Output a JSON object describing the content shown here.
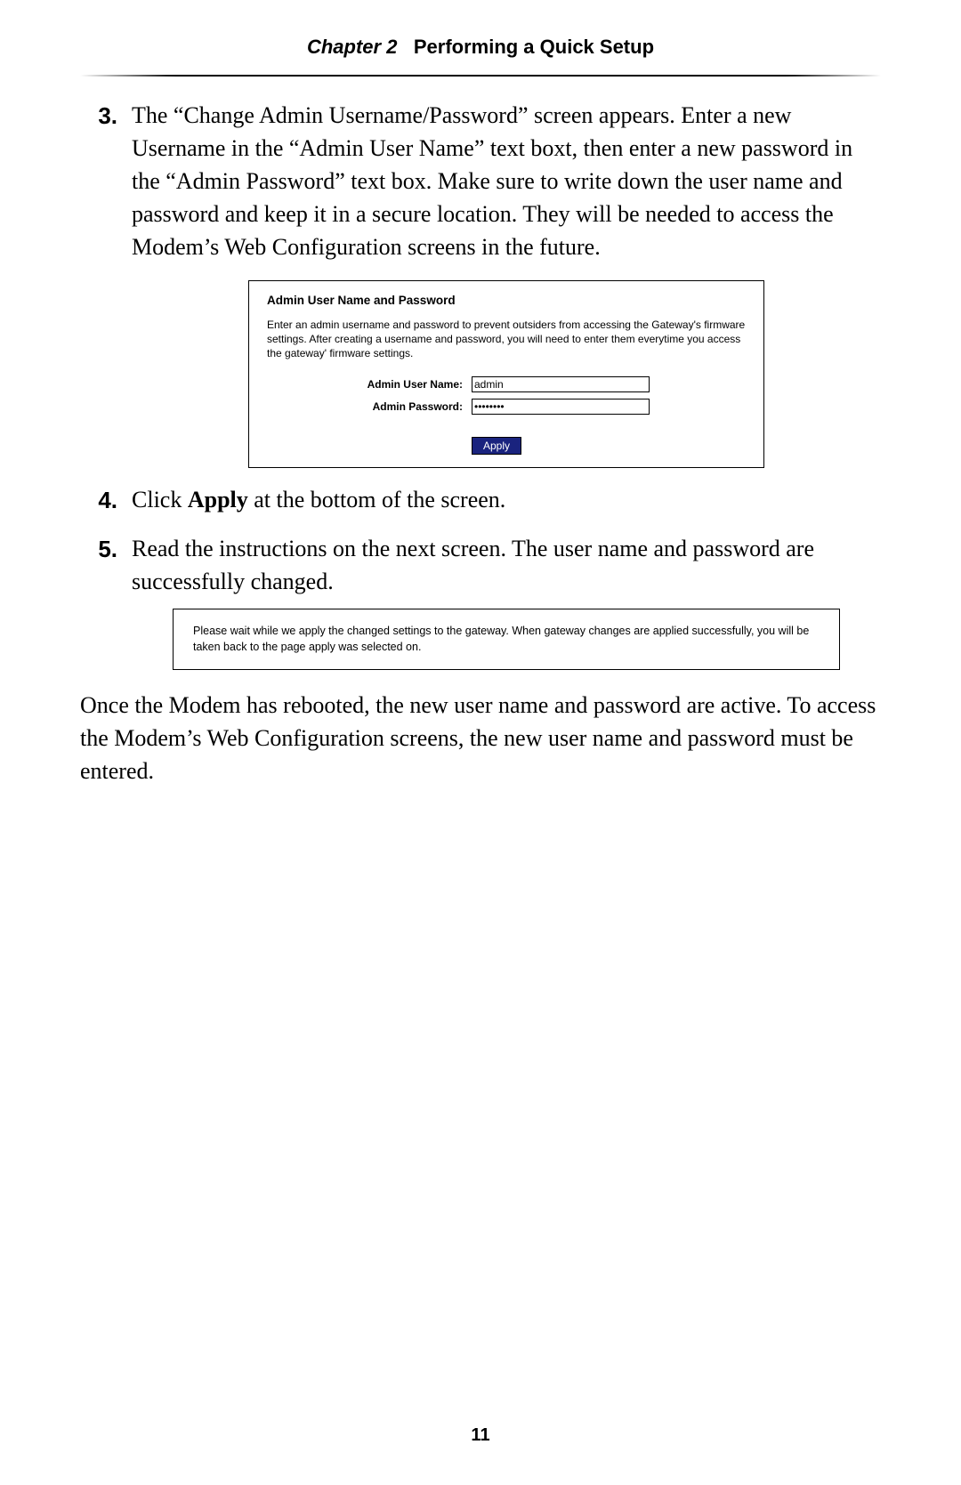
{
  "header": {
    "chapter_label": "Chapter 2",
    "chapter_title": "Performing a Quick Setup"
  },
  "steps": {
    "s3": {
      "num": "3.",
      "text": "The “Change Admin Username/Password” screen appears. Enter a new Username in the “Admin User Name” text boxt, then enter a new password in the “Admin Password” text box. Make sure to write down the user name and password and keep it in a secure location. They will be needed to access the Modem’s Web Configuration screens in the future."
    },
    "s4": {
      "num": "4.",
      "pre": "Click ",
      "bold": "Apply",
      "post": " at the bottom of the screen."
    },
    "s5": {
      "num": "5.",
      "text": "Read the instructions on the next screen. The user name and password are successfully changed."
    }
  },
  "dialog1": {
    "title": "Admin User Name and Password",
    "description": "Enter an admin username and password to prevent outsiders from accessing the Gateway's firmware settings. After creating a username and password, you will need to enter them everytime you access the gateway' firmware settings.",
    "username_label": "Admin User Name:",
    "username_value": "admin",
    "password_label": "Admin Password:",
    "password_value": "••••••••",
    "apply_label": "Apply"
  },
  "dialog2": {
    "text": "Please wait while we apply the changed settings to the gateway. When gateway changes are applied successfully, you will be taken back to the page apply was selected on."
  },
  "trailing": "Once the Modem has rebooted, the new user name and password are active. To access the Modem’s Web Configuration screens, the new user name and password must be entered.",
  "page_number": "11"
}
